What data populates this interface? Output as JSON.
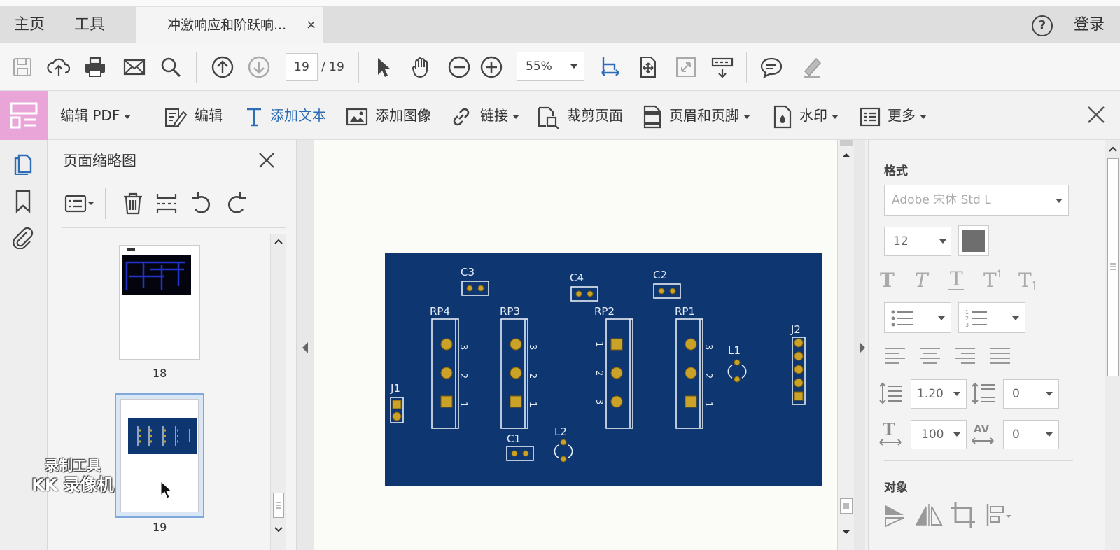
{
  "tabbar": {
    "home": "主页",
    "tools": "工具",
    "doc_tab_title": "冲激响应和阶跃响...",
    "doc_tab_close": "×",
    "help": "?",
    "login": "登录"
  },
  "toolbar": {
    "page_current": "19",
    "page_total": "/ 19",
    "zoom": "55%"
  },
  "editbar": {
    "edit_pdf": "编辑 PDF",
    "edit": "编辑",
    "add_text": "添加文本",
    "add_image": "添加图像",
    "link": "链接",
    "crop": "裁剪页面",
    "header_footer": "页眉和页脚",
    "watermark": "水印",
    "more": "更多"
  },
  "thumbnails": {
    "title": "页面缩略图",
    "pages": [
      {
        "label": "18"
      },
      {
        "label": "19",
        "selected": true
      }
    ]
  },
  "format_panel": {
    "section_format": "格式",
    "font": "Adobe 宋体 Std L",
    "font_size": "12",
    "line_spacing": "1.20",
    "para_spacing": "0",
    "horizontal_scale": "100",
    "char_spacing": "0",
    "section_object": "对象"
  },
  "pcb": {
    "background_color": "#0e3772",
    "labels": {
      "C3": "C3",
      "C4": "C4",
      "C2": "C2",
      "C1": "C1",
      "RP4": "RP4",
      "RP3": "RP3",
      "RP2": "RP2",
      "RP1": "RP1",
      "J1": "J1",
      "J2": "J2",
      "L1": "L1",
      "L2": "L2",
      "n1": "1",
      "n2": "2",
      "n3": "3"
    }
  },
  "watermark": {
    "line1": "录制工具",
    "line2": "KK 录像机"
  },
  "colors": {
    "accent_blue": "#2d6db5",
    "edit_badge": "#e9a4d8",
    "pcb_board": "#0e3772",
    "pad_gold": "#c9a227"
  }
}
